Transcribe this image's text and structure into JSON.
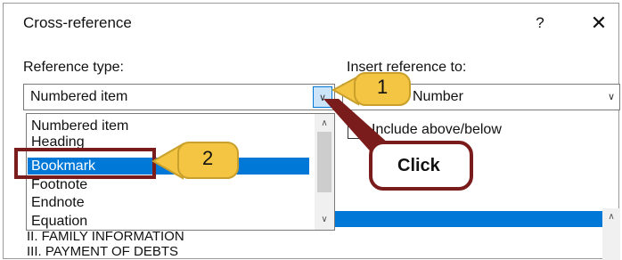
{
  "dialog": {
    "title": "Cross-reference",
    "help": "?",
    "close": "✕"
  },
  "reference_type": {
    "label": "Reference type:",
    "value": "Numbered item",
    "options": [
      "Numbered item",
      "Heading",
      "Bookmark",
      "Footnote",
      "Endnote",
      "Equation"
    ],
    "selected": "Bookmark"
  },
  "insert_reference": {
    "label": "Insert reference to:",
    "value": "Number"
  },
  "include_above_below": {
    "label": "Include above/below",
    "checked": false
  },
  "for_which_list": [
    "II. FAMILY INFORMATION",
    "III. PAYMENT OF DEBTS"
  ],
  "callouts": {
    "step1": "1",
    "step2": "2",
    "click": "Click"
  },
  "colors": {
    "accent": "#0078d7",
    "callout_fill": "#f4c542",
    "click_border": "#7b1c1c",
    "highlight_border": "#7b1c1c"
  },
  "icons": {
    "dropdown": "chevron-down-icon",
    "scroll_up": "chevron-up-icon",
    "scroll_down": "chevron-down-icon"
  }
}
